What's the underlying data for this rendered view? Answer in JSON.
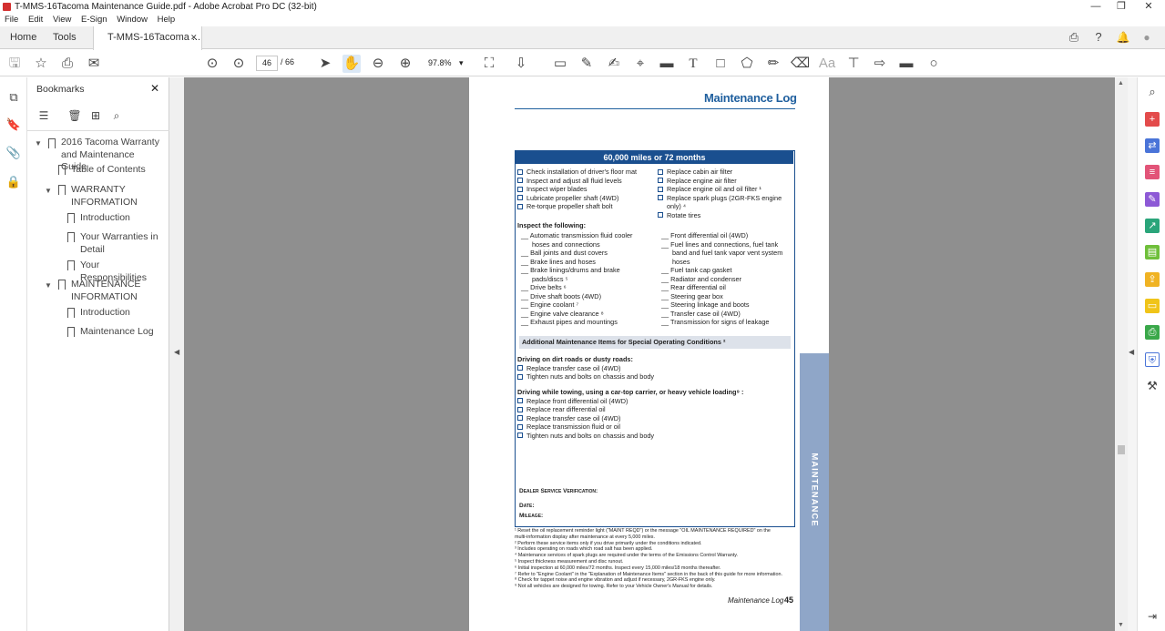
{
  "window": {
    "title": "T-MMS-16Tacoma Maintenance Guide.pdf - Adobe Acrobat Pro DC (32-bit)",
    "minimize": "—",
    "restore": "❐",
    "close": "✕"
  },
  "menu": [
    "File",
    "Edit",
    "View",
    "E-Sign",
    "Window",
    "Help"
  ],
  "tabs": {
    "home": "Home",
    "tools": "Tools",
    "doc": "T-MMS-16Tacoma ...",
    "doc_close": "✕"
  },
  "toolbar": {
    "page_current": "46",
    "page_total": "/ 66",
    "zoom": "97.8%",
    "zoom_arrow": "▾"
  },
  "bookmarks": {
    "header": "Bookmarks",
    "close": "✕",
    "items": [
      {
        "label": "2016 Tacoma Warranty and Maintenance Guide"
      },
      {
        "label": "Table of Contents"
      },
      {
        "label": "WARRANTY INFORMATION"
      },
      {
        "label": "Introduction"
      },
      {
        "label": "Your Warranties in Detail"
      },
      {
        "label": "Your Responsibilities"
      },
      {
        "label": "MAINTENANCE INFORMATION"
      },
      {
        "label": "Introduction"
      },
      {
        "label": "Maintenance Log"
      }
    ]
  },
  "doc": {
    "header": "Maintenance Log",
    "box_title": "60,000 miles or 72 months",
    "left_checks": [
      "Check installation of driver's floor mat",
      "Inspect and adjust all fluid levels",
      "Inspect wiper blades",
      "Lubricate propeller shaft (4WD)",
      "Re-torque propeller shaft bolt"
    ],
    "right_checks": [
      "Replace cabin air filter",
      "Replace engine air filter",
      "Replace engine oil and oil filter ¹",
      "Replace spark plugs (2GR-FKS engine",
      "only) ⁴",
      "Rotate tires"
    ],
    "inspect_heading": "Inspect the following:",
    "inspect_left": [
      "__ Automatic transmission fluid cooler",
      "hoses and connections",
      "__ Ball joints and dust covers",
      "__ Brake lines and hoses",
      "__ Brake linings/drums and brake",
      "pads/discs ⁵",
      "__ Drive belts ⁶",
      "__ Drive shaft boots (4WD)",
      "__ Engine coolant ⁷",
      "__ Engine valve clearance ⁸",
      "__ Exhaust pipes and mountings"
    ],
    "inspect_right": [
      "__ Front differential oil (4WD)",
      "__ Fuel lines and connections, fuel tank",
      "band and fuel tank vapor vent system",
      "hoses",
      "__ Fuel tank cap gasket",
      "__ Radiator and condenser",
      "__ Rear differential oil",
      "__ Steering gear box",
      "__ Steering linkage and boots",
      "__ Transfer case oil (4WD)",
      "__ Transmission for signs of leakage"
    ],
    "additional": "Additional Maintenance Items for Special Operating Conditions ²",
    "dirt_heading": "Driving on dirt roads or dusty roads:",
    "dirt_items": [
      "Replace transfer case oil (4WD)",
      "Tighten nuts and bolts on chassis and body"
    ],
    "tow_heading": "Driving while towing, using a car-top carrier, or heavy vehicle loading⁹ :",
    "tow_items": [
      "Replace front differential oil (4WD)",
      "Replace rear differential oil",
      "Replace transfer case oil (4WD)",
      "Replace transmission fluid or oil",
      "Tighten nuts and bolts on chassis and body"
    ],
    "dealer": "Dealer Service Verification:",
    "date": "Date:",
    "mileage": "Mileage:",
    "footnotes": [
      "¹ Reset the oil replacement reminder light (\"MAINT REQD\") or the message \"OIL MAINTENANCE REQUIRED\" on the",
      "   multi-information display after maintenance at every 5,000 miles.",
      "² Perform these service items only if you drive primarily under the conditions indicated.",
      "³ Includes operating on roads which road salt has been applied.",
      "⁴ Maintenance services of spark plugs are required under the terms of the Emissions Control Warranty.",
      "⁵ Inspect thickness measurement and disc runout.",
      "⁶ Initial inspection at 60,000 miles/72 months. Inspect every 15,000 miles/18 months thereafter.",
      "⁷ Refer to \"Engine Coolant\" in the \"Explanation of Maintenance Items\" section in the back of this guide for more information.",
      "⁸ Check for tappet noise and engine vibration and adjust if necessary, 2GR-FKS engine only.",
      "⁹ Not all vehicles are designed for towing. Refer to your Vehicle Owner's Manual for details."
    ],
    "footer_label": "Maintenance Log",
    "page_number": "45",
    "side_tab": "MAINTENANCE"
  },
  "colors": {
    "doc_blue": "#1a4f8f",
    "side_tab": "#8fa6c8",
    "viewport_bg": "#8f8f8f"
  }
}
